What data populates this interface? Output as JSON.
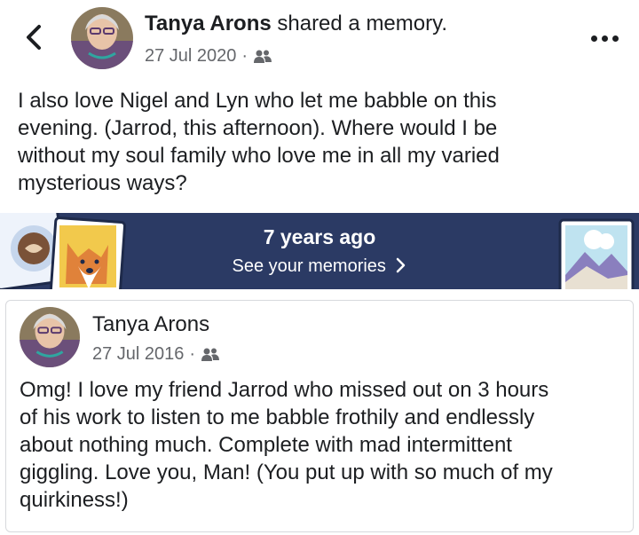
{
  "header": {
    "author_name": "Tanya Arons",
    "action_text": " shared a memory.",
    "date": "27 Jul 2020",
    "separator": "·",
    "audience_icon": "friends-icon",
    "back_icon": "chevron-left-icon",
    "more_icon": "more-horizontal-icon"
  },
  "share_text": "I also love Nigel and Lyn  who let me babble on this\nevening.  (Jarrod, this afternoon). Where would I be\nwithout my soul family who love me in all my varied\nmysterious ways?",
  "memory_banner": {
    "title": "7 years ago",
    "link_label": "See your memories",
    "link_icon": "chevron-right-icon",
    "background_color": "#2b3a64"
  },
  "original_post": {
    "author_name": "Tanya Arons",
    "date": "27 Jul 2016",
    "separator": "·",
    "audience_icon": "friends-icon",
    "text": "Omg!  I love my friend Jarrod who missed out on 3 hours\nof his work to listen to me babble frothily and endlessly\nabout nothing much. Complete with mad intermittent\ngiggling.  Love you, Man!  (You put up with so much of my\nquirkiness!)"
  }
}
